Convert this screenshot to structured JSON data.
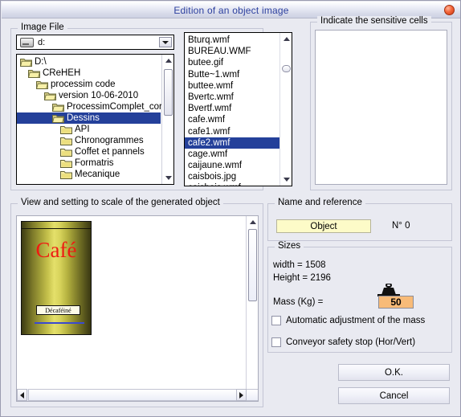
{
  "window": {
    "title": "Edition of an object image",
    "close_icon": "close-icon"
  },
  "image_file_group": {
    "legend": "Image File",
    "drive_combo": {
      "value": "d:",
      "icon": "drive-icon",
      "arrow_icon": "chevron-down-icon"
    },
    "tree": [
      {
        "label": "D:\\",
        "depth": 0,
        "icon": "folder-open-icon",
        "selected": false
      },
      {
        "label": "CReHEH",
        "depth": 1,
        "icon": "folder-open-icon",
        "selected": false
      },
      {
        "label": "processim code",
        "depth": 2,
        "icon": "folder-open-icon",
        "selected": false
      },
      {
        "label": "version 10-06-2010",
        "depth": 3,
        "icon": "folder-open-icon",
        "selected": false
      },
      {
        "label": "ProcessimComplet_corrigé_trad",
        "depth": 4,
        "icon": "folder-open-icon",
        "selected": false
      },
      {
        "label": "Dessins",
        "depth": 4,
        "icon": "folder-open-icon",
        "selected": true
      },
      {
        "label": "API",
        "depth": 5,
        "icon": "folder-closed-icon",
        "selected": false
      },
      {
        "label": "Chronogrammes",
        "depth": 5,
        "icon": "folder-closed-icon",
        "selected": false
      },
      {
        "label": "Coffet et pannels",
        "depth": 5,
        "icon": "folder-closed-icon",
        "selected": false
      },
      {
        "label": "Formatris",
        "depth": 5,
        "icon": "folder-closed-icon",
        "selected": false
      },
      {
        "label": "Mecanique",
        "depth": 5,
        "icon": "folder-closed-icon",
        "selected": false
      }
    ],
    "files": [
      {
        "label": "Bturq.wmf",
        "selected": false
      },
      {
        "label": "BUREAU.WMF",
        "selected": false
      },
      {
        "label": "butee.gif",
        "selected": false
      },
      {
        "label": "Butte~1.wmf",
        "selected": false
      },
      {
        "label": "buttee.wmf",
        "selected": false
      },
      {
        "label": "Bvertc.wmf",
        "selected": false
      },
      {
        "label": "Bvertf.wmf",
        "selected": false
      },
      {
        "label": "cafe.wmf",
        "selected": false
      },
      {
        "label": "cafe1.wmf",
        "selected": false
      },
      {
        "label": "cafe2.wmf",
        "selected": true
      },
      {
        "label": "cage.wmf",
        "selected": false
      },
      {
        "label": "caijaune.wmf",
        "selected": false
      },
      {
        "label": "caisbois.jpg",
        "selected": false
      },
      {
        "label": "caisbois.wmf",
        "selected": false
      }
    ]
  },
  "sensitive_cells_group": {
    "legend": "Indicate the sensitive cells"
  },
  "preview_group": {
    "legend": "View and setting to scale of the generated object",
    "object_image": {
      "brand_text": "Café",
      "label_text": "Décaféiné"
    }
  },
  "name_reference_group": {
    "legend": "Name and reference",
    "name_value": "Object",
    "reference": "N° 0"
  },
  "sizes_group": {
    "legend": "Sizes",
    "width_line": "width = 1508",
    "height_line": "Height = 2196",
    "mass_label": "Mass (Kg) =",
    "mass_value": "50",
    "weight_icon": "weight-icon",
    "checkbox_auto_mass": "Automatic adjustment of the mass",
    "checkbox_conveyor_stop": "Conveyor safety stop (Hor/Vert)"
  },
  "buttons": {
    "ok": "O.K.",
    "cancel": "Cancel"
  },
  "colors": {
    "title_text": "#2b3f9e",
    "selection": "#24409a",
    "name_field_bg": "#fdfbc8",
    "mass_field_bg": "#f8bb78",
    "close_button": "#f4663a",
    "cafe_red": "#ee1b12"
  }
}
